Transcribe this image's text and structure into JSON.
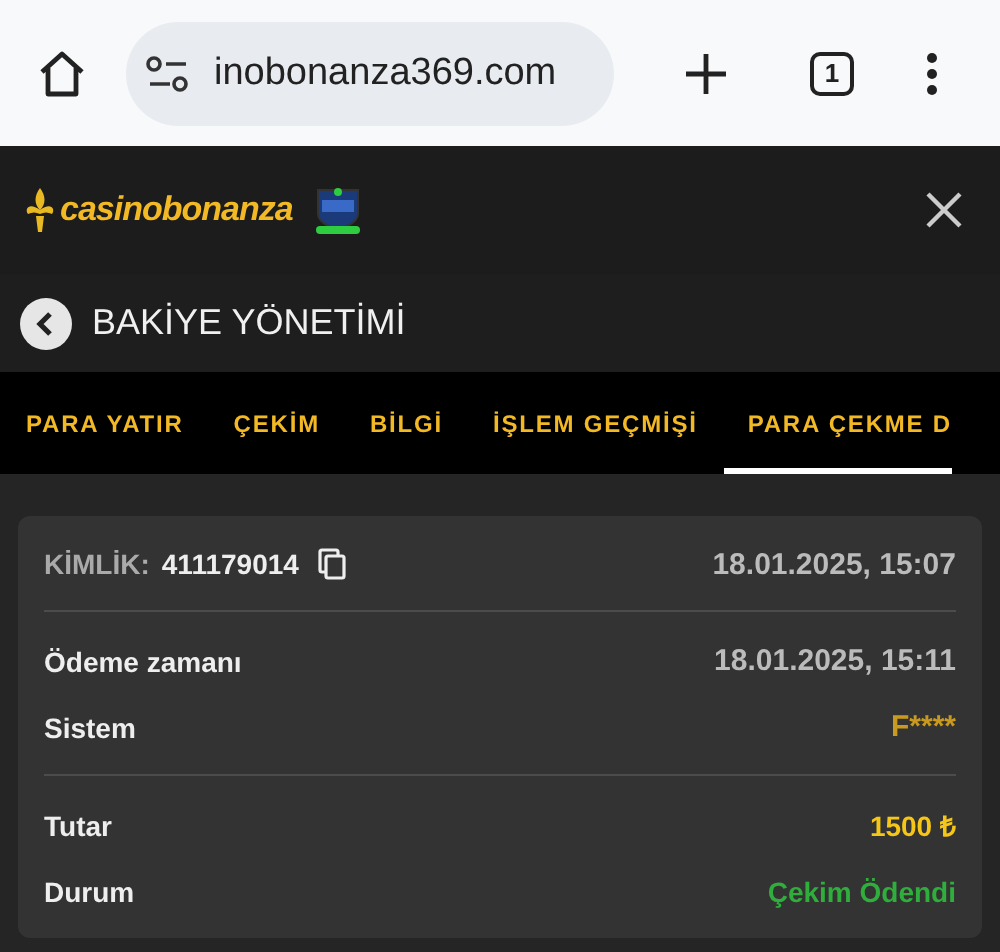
{
  "browser": {
    "url": "inobonanza369.com",
    "tab_count": "1"
  },
  "header": {
    "logo": "casinobonanza"
  },
  "title_bar": {
    "title": "BAKİYE YÖNETİMİ"
  },
  "tabs": [
    {
      "label": "PARA YATIR",
      "selected": false
    },
    {
      "label": "ÇEKİM",
      "selected": false
    },
    {
      "label": "BİLGİ",
      "selected": false
    },
    {
      "label": "İŞLEM GEÇMİŞİ",
      "selected": false
    },
    {
      "label": "PARA ÇEKME D",
      "selected": true
    }
  ],
  "card": {
    "id_label": "KİMLİK:",
    "id_value": "411179014",
    "created": "18.01.2025, 15:07",
    "sections": [
      {
        "rows": [
          {
            "label": "Ödeme zamanı",
            "value": "18.01.2025, 15:11",
            "kind": "plain"
          },
          {
            "label": "Sistem",
            "value": "F****",
            "kind": "accent"
          }
        ]
      },
      {
        "rows": [
          {
            "label": "Tutar",
            "value": "1500 ₺",
            "kind": "amount"
          },
          {
            "label": "Durum",
            "value": "Çekim Ödendi",
            "kind": "success"
          }
        ]
      }
    ]
  }
}
